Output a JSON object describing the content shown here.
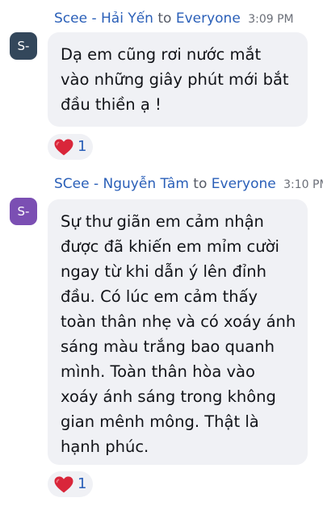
{
  "messages": [
    {
      "sender": "Scee - Hải Yến",
      "to_word": "to",
      "recipient": "Everyone",
      "time": "3:09 PM",
      "avatar_initials": "S-",
      "lines": [
        "Dạ em cũng rơi nước mắt",
        "vào những giây phút mới bắt",
        "đầu thiền ạ !"
      ],
      "reaction": {
        "icon": "heart-icon",
        "count": "1"
      }
    },
    {
      "sender": "SCee - Nguyễn Tâm",
      "to_word": "to",
      "recipient": "Everyone",
      "time": "3:10 PM",
      "avatar_initials": "S-",
      "lines": [
        "Sự thư giãn em cảm nhận",
        "được đã khiến em mỉm cười",
        "ngay từ khi dẫn ý lên đỉnh",
        "đầu. Có lúc em cảm thấy",
        "toàn thân nhẹ và có xoáy ánh",
        "sáng màu trắng bao quanh",
        "mình. Toàn thân hòa vào",
        "xoáy ánh sáng trong không",
        "gian mênh mông. Thật là",
        "hạnh phúc."
      ],
      "reaction": {
        "icon": "heart-icon",
        "count": "1"
      }
    }
  ],
  "colors": {
    "sender_link": "#2a5fb8",
    "bubble_bg": "#f0f1f5",
    "avatar_1": "#33475b",
    "avatar_2": "#7b4fb3",
    "heart": "#d9263a"
  }
}
